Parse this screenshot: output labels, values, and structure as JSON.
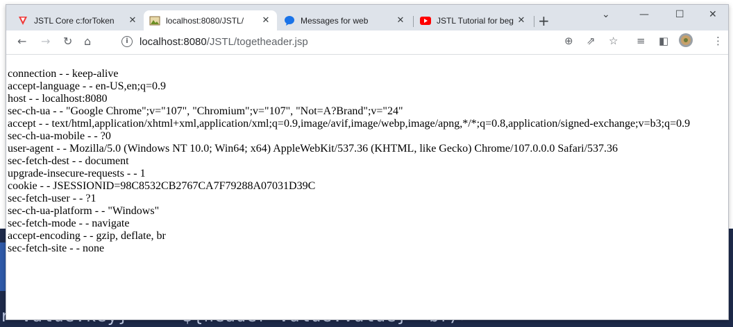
{
  "tabs": [
    {
      "title": "JSTL Core c:forToken",
      "icon": "vivaldi-v-icon"
    },
    {
      "title": "localhost:8080/JSTL/",
      "icon": "page-image-icon"
    },
    {
      "title": "Messages for web",
      "icon": "messages-bubble-icon"
    },
    {
      "title": "JSTL Tutorial for beg",
      "icon": "youtube-icon"
    }
  ],
  "address_bar": {
    "host": "localhost:8080",
    "path": "/JSTL/togetheader.jsp"
  },
  "headers": [
    "connection - - keep-alive",
    "accept-language - - en-US,en;q=0.9",
    "host - - localhost:8080",
    "sec-ch-ua - - \"Google Chrome\";v=\"107\", \"Chromium\";v=\"107\", \"Not=A?Brand\";v=\"24\"",
    "accept - - text/html,application/xhtml+xml,application/xml;q=0.9,image/avif,image/webp,image/apng,*/*;q=0.8,application/signed-exchange;v=b3;q=0.9",
    "sec-ch-ua-mobile - - ?0",
    "user-agent - - Mozilla/5.0 (Windows NT 10.0; Win64; x64) AppleWebKit/537.36 (KHTML, like Gecko) Chrome/107.0.0.0 Safari/537.36",
    "sec-fetch-dest - - document",
    "upgrade-insecure-requests - - 1",
    "cookie - - JSESSIONID=98C8532CB2767CA7F79288A07031D39C",
    "sec-fetch-user - - ?1",
    "sec-ch-ua-platform - - \"Windows\"",
    "sec-fetch-mode - - navigate",
    "accept-encoding - - gzip, deflate, br",
    "sec-fetch-site - - none"
  ],
  "background_code": "r Value.key} - - ${header Value.value} <br/>",
  "colors": {
    "tabbar_bg": "#dee3ea",
    "youtube_red": "#ff0000",
    "vivaldi_red": "#ef3939",
    "messages_blue": "#1a73e8"
  }
}
